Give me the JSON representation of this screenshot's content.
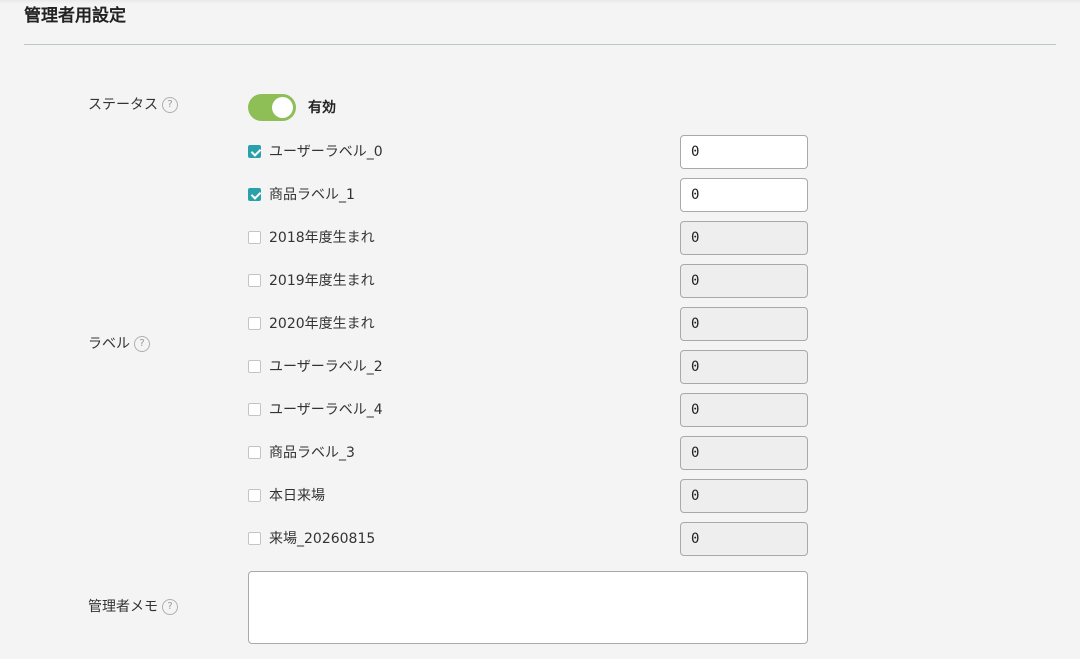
{
  "section": {
    "title": "管理者用設定"
  },
  "status": {
    "label": "ステータス",
    "help": "?",
    "toggle_on": true,
    "toggle_text": "有効"
  },
  "labels": {
    "label": "ラベル",
    "help": "?",
    "items": [
      {
        "text": "ユーザーラベル_0",
        "checked": true,
        "value": "0"
      },
      {
        "text": "商品ラベル_1",
        "checked": true,
        "value": "0"
      },
      {
        "text": "2018年度生まれ",
        "checked": false,
        "value": "0"
      },
      {
        "text": "2019年度生まれ",
        "checked": false,
        "value": "0"
      },
      {
        "text": "2020年度生まれ",
        "checked": false,
        "value": "0"
      },
      {
        "text": "ユーザーラベル_2",
        "checked": false,
        "value": "0"
      },
      {
        "text": "ユーザーラベル_4",
        "checked": false,
        "value": "0"
      },
      {
        "text": "商品ラベル_3",
        "checked": false,
        "value": "0"
      },
      {
        "text": "本日来場",
        "checked": false,
        "value": "0"
      },
      {
        "text": "来場_20260815",
        "checked": false,
        "value": "0"
      }
    ]
  },
  "memo": {
    "label": "管理者メモ",
    "help": "?",
    "value": ""
  },
  "colors": {
    "toggle_on": "#8ebf57",
    "checkbox_checked": "#2aa1aa",
    "divider": "#b9c9c0"
  }
}
